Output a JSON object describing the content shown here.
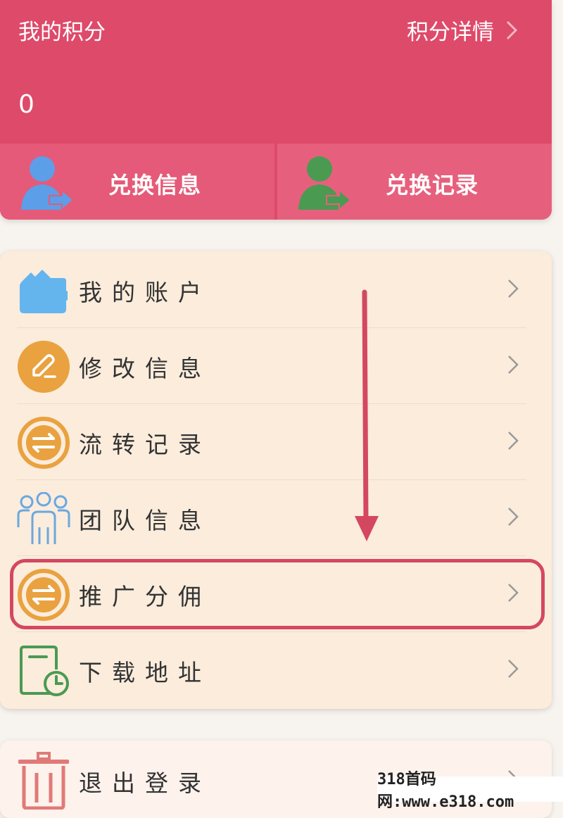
{
  "points": {
    "title": "我的积分",
    "detail_label": "积分详情",
    "value": "0",
    "exchange_info_label": "兑换信息",
    "exchange_record_label": "兑换记录"
  },
  "menu": {
    "items": [
      {
        "label": "我的账户",
        "icon": "wallet-icon"
      },
      {
        "label": "修改信息",
        "icon": "edit-icon"
      },
      {
        "label": "流转记录",
        "icon": "transfer-icon"
      },
      {
        "label": "团队信息",
        "icon": "team-icon"
      },
      {
        "label": "推广分佣",
        "icon": "commission-icon"
      },
      {
        "label": "下载地址",
        "icon": "download-icon"
      }
    ]
  },
  "logout": {
    "label": "退出登录",
    "icon": "trash-icon"
  },
  "watermark": "318首码网:www.e318.com",
  "colors": {
    "points_bg": "#de4a6a",
    "menu_bg": "#fbecdc",
    "highlight": "#d4485f",
    "orange": "#e9a23f",
    "blue": "#6aaee8",
    "green": "#4aa04e"
  }
}
